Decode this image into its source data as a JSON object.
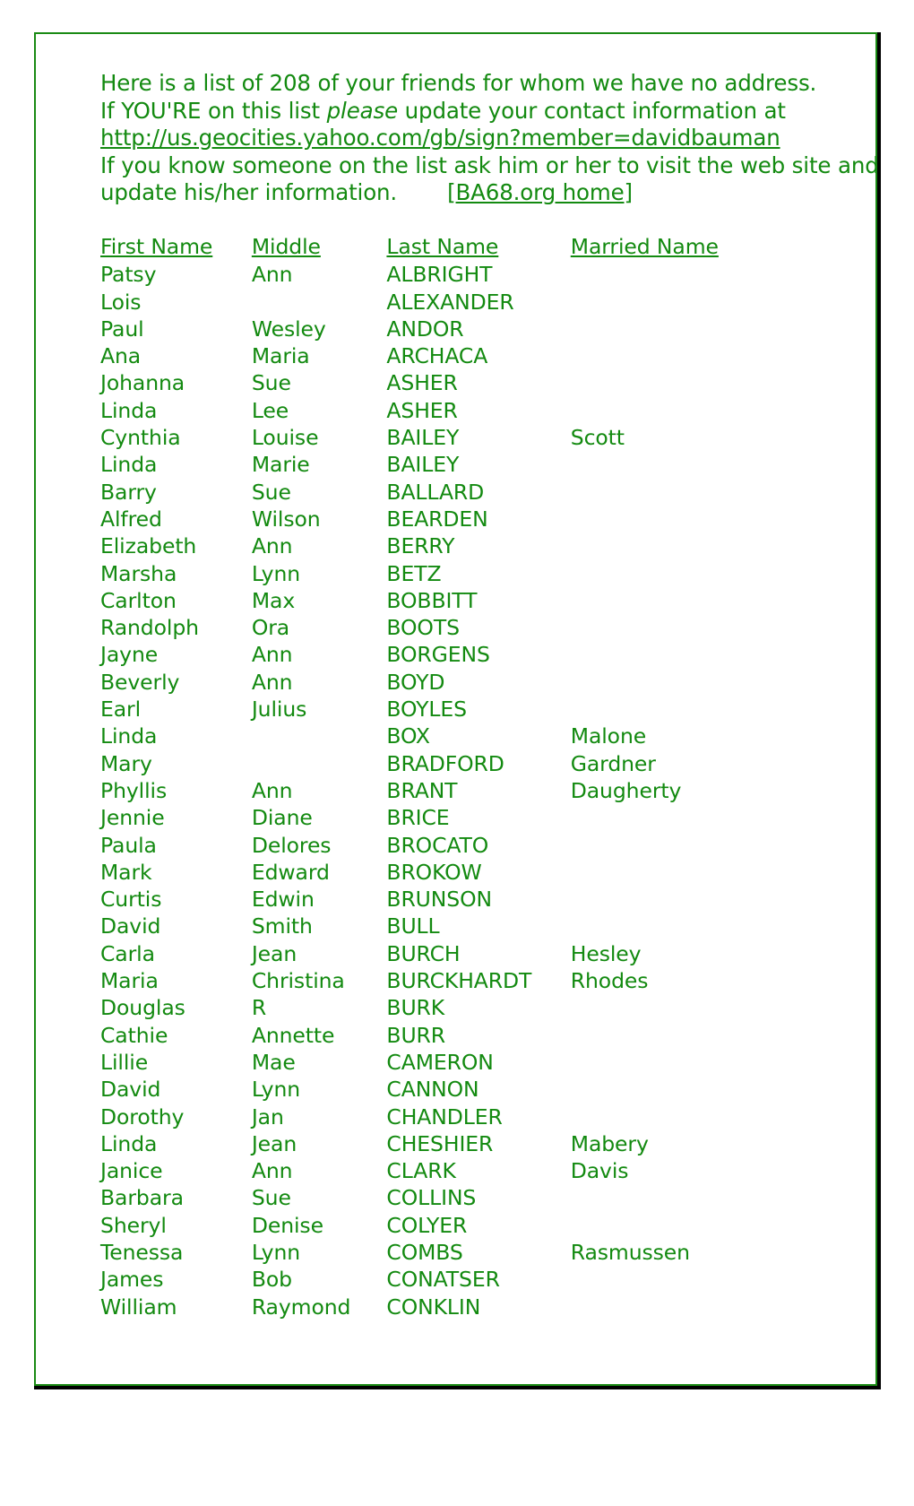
{
  "theme": {
    "text_green": "#138a10",
    "border_green": "#1a8a14",
    "shadow": "#000000",
    "background": "#ffffff"
  },
  "intro": {
    "line1": "Here is a list of 208 of your friends for whom we have no address.",
    "line2_before": "If YOU'RE on this list ",
    "line2_emphasis": "please",
    "line2_after": " update your contact information at",
    "signup_link": "http://us.geocities.yahoo.com/gb/sign?member=davidbauman",
    "line4": "If you know someone on the list ask him or her to visit the web site and",
    "line5": "update his/her information.",
    "home_link": "[BA68.org home]",
    "friend_count": "208"
  },
  "table": {
    "headers": {
      "first": "First Name",
      "middle": "Middle",
      "last": "Last Name",
      "married": "Married Name"
    },
    "rows": [
      {
        "first": "Patsy",
        "middle": "Ann",
        "last": "ALBRIGHT",
        "married": ""
      },
      {
        "first": "Lois",
        "middle": "",
        "last": "ALEXANDER",
        "married": ""
      },
      {
        "first": "Paul",
        "middle": "Wesley",
        "last": "ANDOR",
        "married": ""
      },
      {
        "first": "Ana",
        "middle": "Maria",
        "last": "ARCHACA",
        "married": ""
      },
      {
        "first": "Johanna",
        "middle": "Sue",
        "last": "ASHER",
        "married": ""
      },
      {
        "first": "Linda",
        "middle": "Lee",
        "last": "ASHER",
        "married": ""
      },
      {
        "first": "Cynthia",
        "middle": "Louise",
        "last": "BAILEY",
        "married": "Scott"
      },
      {
        "first": "Linda",
        "middle": "Marie",
        "last": "BAILEY",
        "married": ""
      },
      {
        "first": "Barry",
        "middle": "Sue",
        "last": "BALLARD",
        "married": ""
      },
      {
        "first": "Alfred",
        "middle": "Wilson",
        "last": "BEARDEN",
        "married": ""
      },
      {
        "first": "Elizabeth",
        "middle": "Ann",
        "last": "BERRY",
        "married": ""
      },
      {
        "first": "Marsha",
        "middle": "Lynn",
        "last": "BETZ",
        "married": ""
      },
      {
        "first": "Carlton",
        "middle": "Max",
        "last": "BOBBITT",
        "married": ""
      },
      {
        "first": "Randolph",
        "middle": "Ora",
        "last": "BOOTS",
        "married": ""
      },
      {
        "first": "Jayne",
        "middle": "Ann",
        "last": "BORGENS",
        "married": ""
      },
      {
        "first": "Beverly",
        "middle": "Ann",
        "last": "BOYD",
        "married": ""
      },
      {
        "first": "Earl",
        "middle": "Julius",
        "last": "BOYLES",
        "married": ""
      },
      {
        "first": "Linda",
        "middle": "",
        "last": "BOX",
        "married": "Malone"
      },
      {
        "first": "Mary",
        "middle": "",
        "last": "BRADFORD",
        "married": "Gardner"
      },
      {
        "first": "Phyllis",
        "middle": "Ann",
        "last": "BRANT",
        "married": "Daugherty"
      },
      {
        "first": "Jennie",
        "middle": "Diane",
        "last": "BRICE",
        "married": ""
      },
      {
        "first": "Paula",
        "middle": "Delores",
        "last": "BROCATO",
        "married": ""
      },
      {
        "first": "Mark",
        "middle": "Edward",
        "last": "BROKOW",
        "married": ""
      },
      {
        "first": "Curtis",
        "middle": "Edwin",
        "last": "BRUNSON",
        "married": ""
      },
      {
        "first": "David",
        "middle": "Smith",
        "last": "BULL",
        "married": ""
      },
      {
        "first": "Carla",
        "middle": "Jean",
        "last": "BURCH",
        "married": "Hesley"
      },
      {
        "first": "Maria",
        "middle": "Christina",
        "last": "BURCKHARDT",
        "married": "Rhodes"
      },
      {
        "first": "Douglas",
        "middle": "R",
        "last": "BURK",
        "married": ""
      },
      {
        "first": "Cathie",
        "middle": "Annette",
        "last": "BURR",
        "married": ""
      },
      {
        "first": "Lillie",
        "middle": "Mae",
        "last": "CAMERON",
        "married": ""
      },
      {
        "first": "David",
        "middle": "Lynn",
        "last": "CANNON",
        "married": ""
      },
      {
        "first": "Dorothy",
        "middle": "Jan",
        "last": "CHANDLER",
        "married": ""
      },
      {
        "first": "Linda",
        "middle": "Jean",
        "last": "CHESHIER",
        "married": "Mabery"
      },
      {
        "first": "Janice",
        "middle": "Ann",
        "last": "CLARK",
        "married": "Davis"
      },
      {
        "first": "Barbara",
        "middle": "Sue",
        "last": "COLLINS",
        "married": ""
      },
      {
        "first": "Sheryl",
        "middle": "Denise",
        "last": "COLYER",
        "married": ""
      },
      {
        "first": "Tenessa",
        "middle": "Lynn",
        "last": "COMBS",
        "married": "Rasmussen"
      },
      {
        "first": "James",
        "middle": "Bob",
        "last": "CONATSER",
        "married": ""
      },
      {
        "first": "William",
        "middle": "Raymond",
        "last": "CONKLIN",
        "married": ""
      }
    ]
  }
}
